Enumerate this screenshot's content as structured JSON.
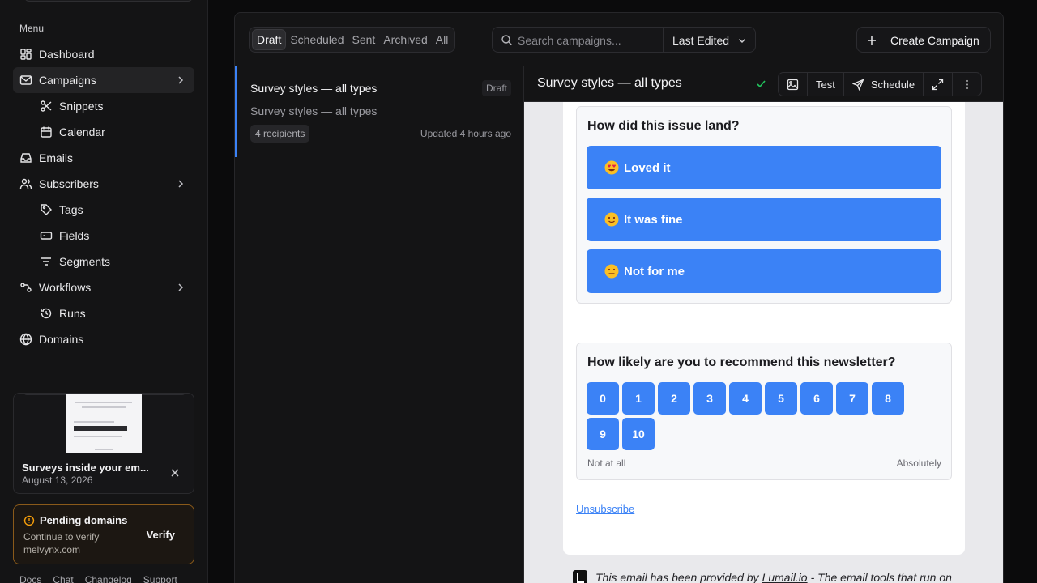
{
  "sidebar": {
    "menu_label": "Menu",
    "items": [
      {
        "label": "Dashboard",
        "icon": "dashboard-icon"
      },
      {
        "label": "Campaigns",
        "icon": "mail-icon"
      },
      {
        "label": "Snippets",
        "icon": "scissors-icon"
      },
      {
        "label": "Calendar",
        "icon": "calendar-icon"
      },
      {
        "label": "Emails",
        "icon": "inbox-icon"
      },
      {
        "label": "Subscribers",
        "icon": "users-icon"
      },
      {
        "label": "Tags",
        "icon": "tag-icon"
      },
      {
        "label": "Fields",
        "icon": "fields-icon"
      },
      {
        "label": "Segments",
        "icon": "filter-icon"
      },
      {
        "label": "Workflows",
        "icon": "workflow-icon"
      },
      {
        "label": "Runs",
        "icon": "history-icon"
      },
      {
        "label": "Domains",
        "icon": "globe-icon"
      }
    ],
    "preview": {
      "title": "Surveys inside your em...",
      "date": "August 13, 2026"
    },
    "pending": {
      "title": "Pending domains",
      "desc": "Continue to verify melvynx.com",
      "action": "Verify"
    },
    "footer": [
      "Docs",
      "Chat",
      "Changelog",
      "Support"
    ]
  },
  "toolbar": {
    "filters": [
      "Draft",
      "Scheduled",
      "Sent",
      "Archived",
      "All"
    ],
    "active_filter": "Draft",
    "search_placeholder": "Search campaigns...",
    "sort": "Last Edited",
    "create_label": "Create Campaign"
  },
  "list": {
    "title": "Survey styles — all types",
    "badge": "Draft",
    "subtitle": "Survey styles — all types",
    "recipients": "4 recipients",
    "updated": "Updated 4 hours ago"
  },
  "detail": {
    "title": "Survey styles — all types",
    "test_label": "Test",
    "schedule_label": "Schedule"
  },
  "email": {
    "q1": {
      "title": "How did this issue land?",
      "options": [
        {
          "label": "Loved it",
          "emoji": "heart-eyes-emoji"
        },
        {
          "label": "It was fine",
          "emoji": "slight-smile-emoji"
        },
        {
          "label": "Not for me",
          "emoji": "neutral-face-emoji"
        }
      ]
    },
    "q2": {
      "title": "How likely are you to recommend this newsletter?",
      "scale": [
        "0",
        "1",
        "2",
        "3",
        "4",
        "5",
        "6",
        "7",
        "8",
        "9",
        "10"
      ],
      "low_label": "Not at all",
      "high_label": "Absolutely"
    },
    "unsubscribe": "Unsubscribe",
    "provided_prefix": "This email has been provided by",
    "provided_link": "Lumail.io",
    "provided_suffix": "- The email tools that run on"
  },
  "colors": {
    "accent": "#3b82f6",
    "warning": "#f59e0b",
    "success": "#22c55e"
  }
}
